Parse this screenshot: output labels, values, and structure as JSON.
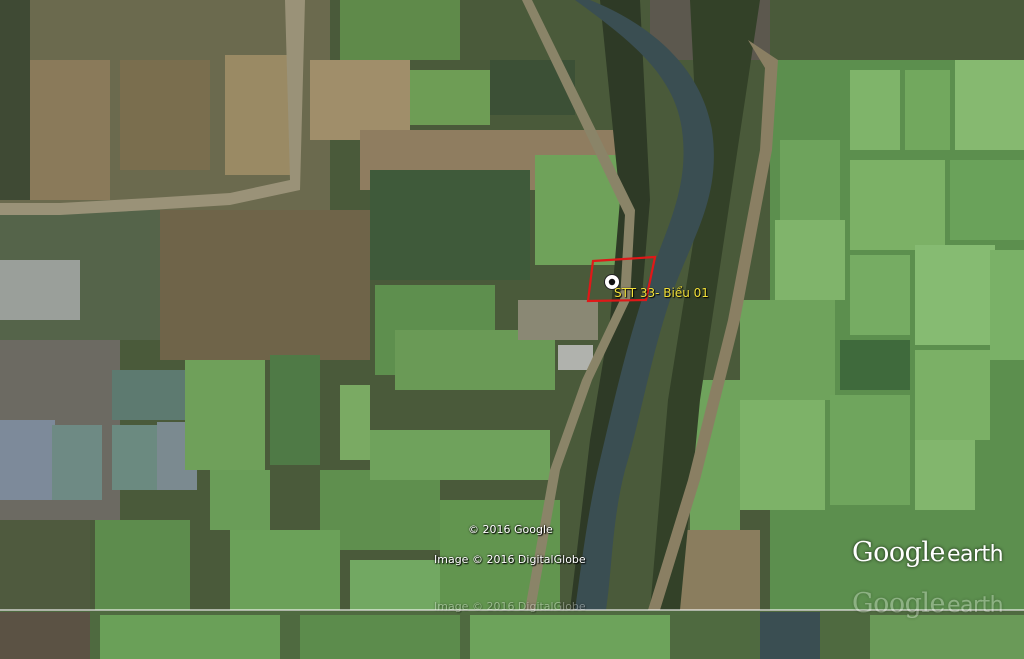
{
  "placemark": {
    "label": "STT 33- Biểu 01",
    "icon": "placemark-circle-icon",
    "boundary_color": "#e01818",
    "label_color": "#f3e23a"
  },
  "credits": {
    "copyright": "© 2016 Google",
    "imagery": "Image © 2016 DigitalGlobe"
  },
  "logo": {
    "word1": "Google",
    "word2": "earth"
  }
}
